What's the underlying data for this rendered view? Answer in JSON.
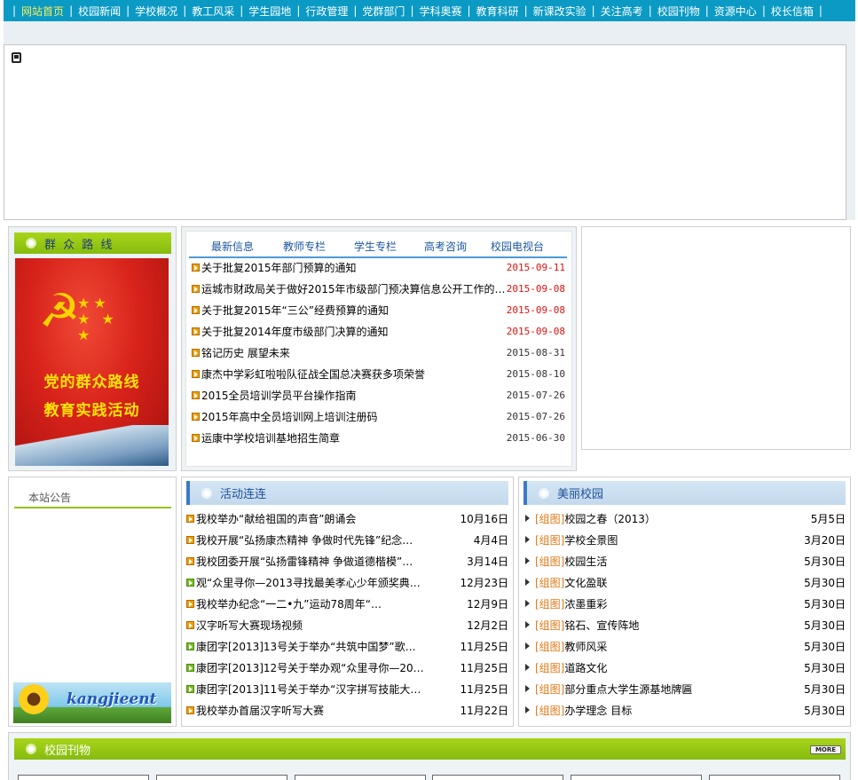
{
  "nav": {
    "items": [
      "网站首页",
      "校园新闻",
      "学校概况",
      "教工风采",
      "学生园地",
      "行政管理",
      "党群部门",
      "学科奥赛",
      "教育科研",
      "新课改实验",
      "关注高考",
      "校园刊物",
      "资源中心",
      "校长信箱"
    ],
    "separator": "|"
  },
  "mass_line": {
    "title": "群 众 路 线",
    "banner_line1": "党的群众路线",
    "banner_line2": "教育实践活动"
  },
  "news": {
    "tabs": [
      "最新信息",
      "教师专栏",
      "学生专栏",
      "高考咨询",
      "校园电视台"
    ],
    "items": [
      {
        "title": "关于批复2015年部门预算的通知",
        "date": "2015-09-11",
        "highlight": true
      },
      {
        "title": "运城市财政局关于做好2015年市级部门预决算信息公开工作的通知",
        "date": "2015-09-08",
        "highlight": true
      },
      {
        "title": "关于批复2015年“三公”经费预算的通知",
        "date": "2015-09-08",
        "highlight": true
      },
      {
        "title": "关于批复2014年度市级部门决算的通知",
        "date": "2015-09-08",
        "highlight": true
      },
      {
        "title": "铭记历史 展望未来",
        "date": "2015-08-31",
        "highlight": false
      },
      {
        "title": "康杰中学彩虹啦啦队征战全国总决赛获多项荣誉",
        "date": "2015-08-10",
        "highlight": false
      },
      {
        "title": "2015全员培训学员平台操作指南",
        "date": "2015-07-26",
        "highlight": false
      },
      {
        "title": "2015年高中全员培训网上培训注册码",
        "date": "2015-07-26",
        "highlight": false
      },
      {
        "title": "运康中学校培训基地招生简章",
        "date": "2015-06-30",
        "highlight": false
      }
    ]
  },
  "notice": {
    "title": "本站公告",
    "logo_text": "kangjieent"
  },
  "activities": {
    "title": "活动连连",
    "items": [
      {
        "title": "我校举办“献给祖国的声音”朗诵会",
        "date": "10月16日",
        "icon": "orange"
      },
      {
        "title": "我校开展“弘扬康杰精神 争做时代先锋”纪念…",
        "date": "4月4日",
        "icon": "orange"
      },
      {
        "title": "我校团委开展“弘扬雷锋精神 争做道德楷模”…",
        "date": "3月14日",
        "icon": "orange"
      },
      {
        "title": "观“众里寻你—2013寻找最美孝心少年颁奖典…",
        "date": "12月23日",
        "icon": "green"
      },
      {
        "title": "我校举办纪念“一二•九”运动78周年“…",
        "date": "12月9日",
        "icon": "orange"
      },
      {
        "title": "汉字听写大赛现场视频",
        "date": "12月2日",
        "icon": "orange"
      },
      {
        "title": "康团字[2013]13号关于举办“共筑中国梦”歌…",
        "date": "11月25日",
        "icon": "green"
      },
      {
        "title": "康团字[2013]12号关于举办观“众里寻你—20…",
        "date": "11月25日",
        "icon": "green"
      },
      {
        "title": "康团字[2013]11号关于举办“汉字拼写技能大…",
        "date": "11月25日",
        "icon": "green"
      },
      {
        "title": "我校举办首届汉字听写大赛",
        "date": "11月22日",
        "icon": "orange"
      }
    ]
  },
  "campus": {
    "title": "美丽校园",
    "tag": "[组图]",
    "items": [
      {
        "title": "校园之春（2013）",
        "date": "5月5日"
      },
      {
        "title": "学校全景图",
        "date": "3月20日"
      },
      {
        "title": "校园生活",
        "date": "5月30日"
      },
      {
        "title": "文化盈联",
        "date": "5月30日"
      },
      {
        "title": "浓墨重彩",
        "date": "5月30日"
      },
      {
        "title": "铭石、宣传阵地",
        "date": "5月30日"
      },
      {
        "title": "教师风采",
        "date": "5月30日"
      },
      {
        "title": "道路文化",
        "date": "5月30日"
      },
      {
        "title": "部分重点大学生源基地牌匾",
        "date": "5月30日"
      },
      {
        "title": "办学理念 目标",
        "date": "5月30日"
      }
    ]
  },
  "journal": {
    "title": "校园刊物",
    "more_label": "MORE"
  },
  "colors": {
    "nav_bg": "#0a9ac4",
    "nav_active": "#ffee55",
    "green_bar": "#9ccc16",
    "date_red": "#e01010",
    "tag_orange": "#e07814"
  }
}
